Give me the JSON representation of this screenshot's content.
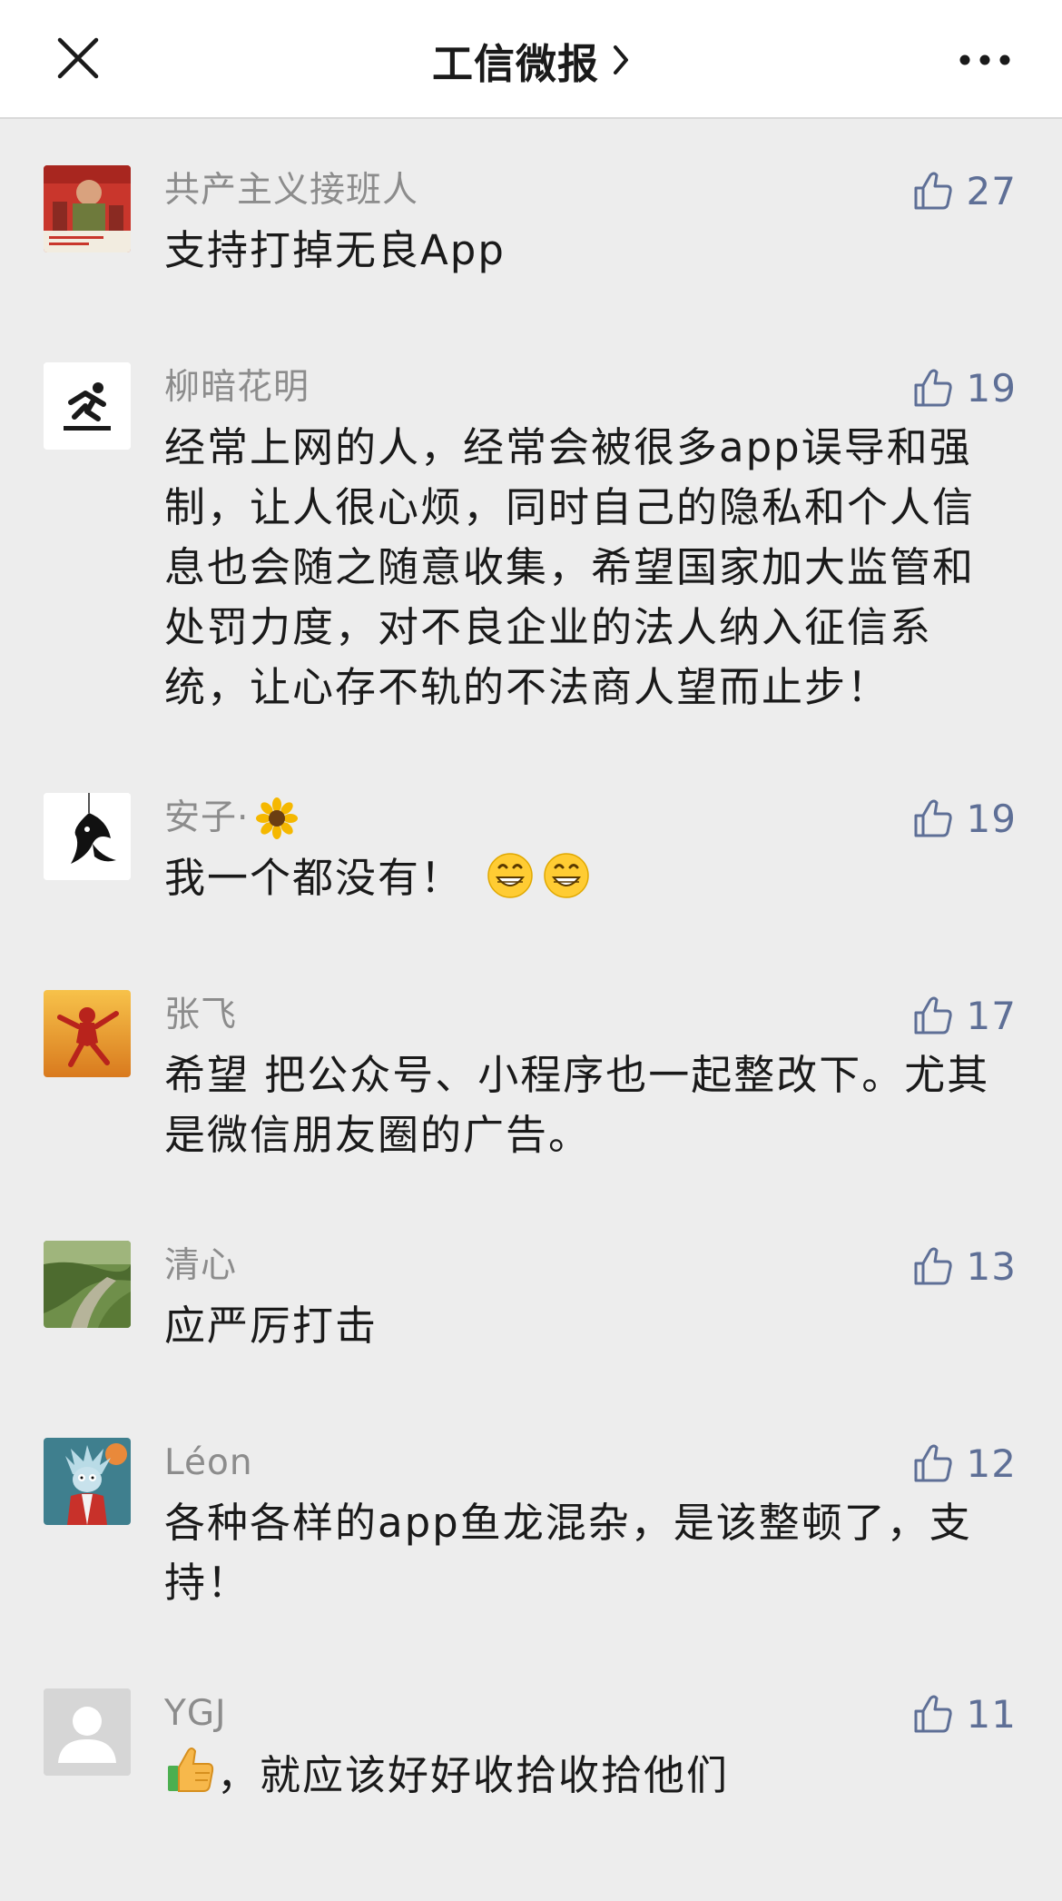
{
  "header": {
    "title": "工信微报",
    "close_icon": "close-icon",
    "chevron_icon": "chevron-right-icon",
    "more_icon": "more-icon"
  },
  "colors": {
    "name": "#8c8c8c",
    "like": "#5e6f96",
    "background": "#ededed"
  },
  "comments": [
    {
      "name": "共产主义接班人",
      "likes": "27",
      "text": "支持打掉无良App",
      "avatar": "propaganda-poster-avatar"
    },
    {
      "name": "柳暗花明",
      "likes": "19",
      "text": "经常上网的人，经常会被很多app误导和强制，让人很心烦，同时自己的隐私和个人信息也会随之随意收集，希望国家加大监管和处罚力度，对不良企业的法人纳入征信系统，让心存不轨的不法商人望而止步！",
      "avatar": "runner-icon-avatar"
    },
    {
      "name": "安子·",
      "name_emoji": "sunflower-emoji",
      "likes": "19",
      "text": "我一个都没有！",
      "text_emoji": [
        "grinning-face-emoji",
        "grinning-face-emoji"
      ],
      "avatar": "ink-bird-avatar"
    },
    {
      "name": "张飞",
      "likes": "17",
      "text": "希望 把公众号、小程序也一起整改下。尤其是微信朋友圈的广告。",
      "avatar": "spider-man-avatar"
    },
    {
      "name": "清心",
      "likes": "13",
      "text": "应严厉打击",
      "avatar": "river-landscape-avatar"
    },
    {
      "name": "Léon",
      "likes": "12",
      "text": "各种各样的app鱼龙混杂，是该整顿了，支持！",
      "avatar": "cartoon-character-avatar"
    },
    {
      "name": "YGJ",
      "likes": "11",
      "text": "，就应该好好收拾收拾他们",
      "text_prefix_emoji": "thumbs-up-emoji",
      "avatar": "default-user-avatar"
    }
  ]
}
